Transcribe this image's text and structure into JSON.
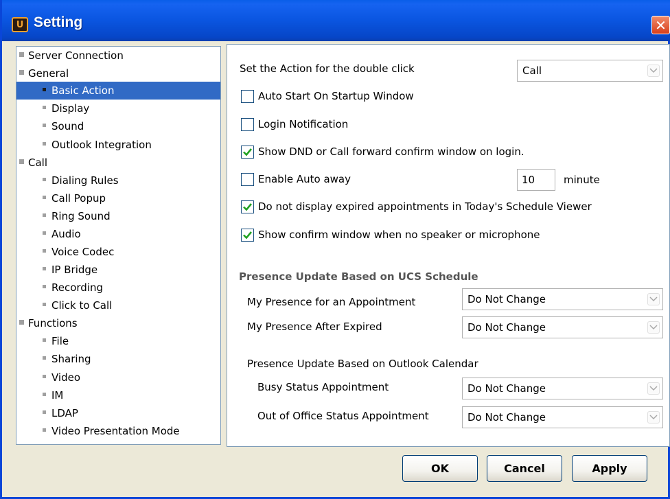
{
  "window": {
    "title": "Setting",
    "app_icon": "U",
    "close_glyph": "✕"
  },
  "nav": {
    "items": [
      {
        "label": "Server Connection"
      },
      {
        "label": "General"
      },
      {
        "label": "Basic Action"
      },
      {
        "label": "Display"
      },
      {
        "label": "Sound"
      },
      {
        "label": "Outlook Integration"
      },
      {
        "label": "Call"
      },
      {
        "label": "Dialing Rules"
      },
      {
        "label": "Call Popup"
      },
      {
        "label": "Ring Sound"
      },
      {
        "label": "Audio"
      },
      {
        "label": "Voice Codec"
      },
      {
        "label": "IP Bridge"
      },
      {
        "label": "Recording"
      },
      {
        "label": "Click to Call"
      },
      {
        "label": "Functions"
      },
      {
        "label": "File"
      },
      {
        "label": "Sharing"
      },
      {
        "label": "Video"
      },
      {
        "label": "IM"
      },
      {
        "label": "LDAP"
      },
      {
        "label": "Video Presentation Mode"
      }
    ]
  },
  "settings": {
    "double_click_label": "Set the Action for the double click",
    "double_click_value": "Call",
    "auto_start_label": "Auto Start On Startup Window",
    "auto_start_checked": false,
    "login_notification_label": "Login Notification",
    "login_notification_checked": false,
    "dnd_confirm_label": "Show DND or Call forward confirm window on login.",
    "dnd_confirm_checked": true,
    "auto_away_label": "Enable Auto away",
    "auto_away_checked": false,
    "auto_away_value": "10",
    "auto_away_unit": "minute",
    "expired_appts_label": "Do not display expired appointments in Today's Schedule Viewer",
    "expired_appts_checked": true,
    "no_speaker_label": "Show confirm window when no speaker or microphone",
    "no_speaker_checked": true
  },
  "presence": {
    "section_title": "Presence Update Based on UCS Schedule",
    "appointment_label": "My Presence for an Appointment",
    "appointment_value": "Do Not Change",
    "after_expired_label": "My Presence After Expired",
    "after_expired_value": "Do Not Change",
    "outlook_title": "Presence Update Based on Outlook Calendar",
    "busy_label": "Busy Status Appointment",
    "busy_value": "Do Not Change",
    "ooo_label": "Out of Office Status Appointment",
    "ooo_value": "Do Not Change"
  },
  "buttons": {
    "ok": "OK",
    "cancel": "Cancel",
    "apply": "Apply"
  },
  "colors": {
    "titlebar": "#0a55e0",
    "selection": "#316ac5",
    "check": "#21a121",
    "dialog_bg": "#ece9d8"
  }
}
